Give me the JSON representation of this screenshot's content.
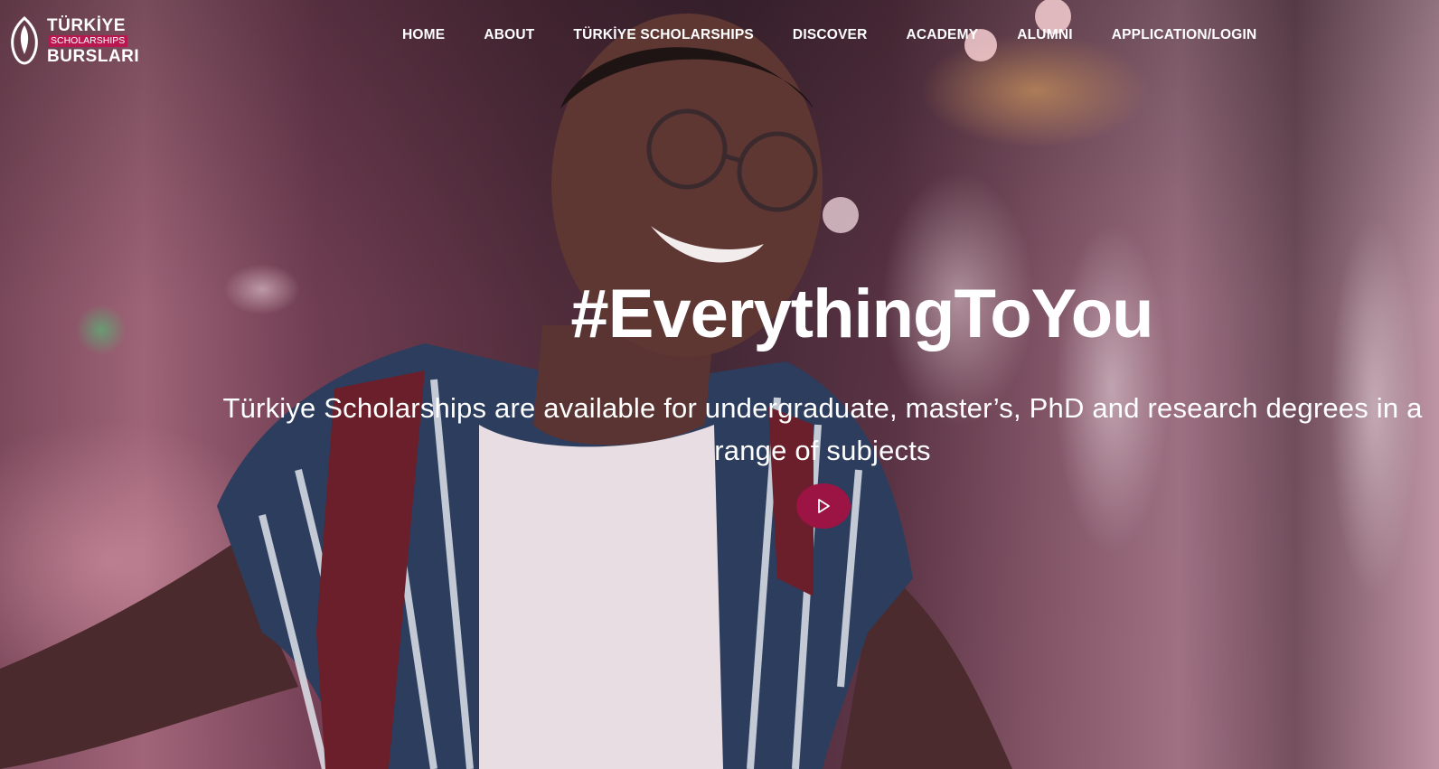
{
  "brand": {
    "line1": "TÜRKİYE",
    "line2": "SCHOLARSHIPS",
    "line3": "BURSLARI",
    "accent_color": "#b8174f"
  },
  "nav": {
    "items": [
      {
        "label": "HOME"
      },
      {
        "label": "ABOUT"
      },
      {
        "label": "TÜRKİYE SCHOLARSHIPS"
      },
      {
        "label": "DISCOVER"
      },
      {
        "label": "ACADEMY"
      },
      {
        "label": "ALUMNI"
      },
      {
        "label": "APPLICATION/LOGIN"
      }
    ]
  },
  "hero": {
    "headline": "#EverythingToYou",
    "subtitle": "Türkiye Scholarships are available for undergraduate, master’s, PhD and research degrees in a range of subjects",
    "play_button_icon": "play-icon",
    "play_button_color": "#9b1444"
  }
}
